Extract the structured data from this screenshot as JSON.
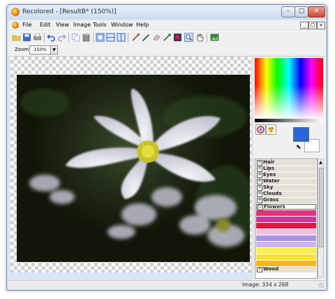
{
  "window": {
    "title": "Recolored - [ResultB* (150%)]"
  },
  "menubar": {
    "items": [
      "File",
      "Edit",
      "View",
      "Image",
      "Tools",
      "Window",
      "Help"
    ]
  },
  "toolbar": {
    "icons": [
      "open-folder-icon",
      "save-icon",
      "print-icon",
      "undo-icon",
      "redo-icon",
      "copy-icon",
      "paste-icon",
      "split-view-icon",
      "split-horizontal-icon",
      "split-vertical-icon",
      "brush-icon",
      "pencil-icon",
      "eraser-icon",
      "dropper-icon",
      "color-fill-icon",
      "zoom-icon",
      "hand-icon",
      "fit-icon"
    ]
  },
  "zoom": {
    "label": "Zoom",
    "value": "150%"
  },
  "palette": {
    "foreground_color": "#2a66d8",
    "background_color": "#ffffff"
  },
  "categories": {
    "items": [
      {
        "label": "Hair",
        "expanded": false
      },
      {
        "label": "Lips",
        "expanded": false
      },
      {
        "label": "Eyes",
        "expanded": false
      },
      {
        "label": "Water",
        "expanded": false
      },
      {
        "label": "Sky",
        "expanded": false
      },
      {
        "label": "Clouds",
        "expanded": false
      },
      {
        "label": "Grass",
        "expanded": false
      },
      {
        "label": "Flowers",
        "expanded": true
      }
    ],
    "flower_colors": [
      "#e0337a",
      "#c9369c",
      "#e8143c",
      "#efc0e3",
      "#a995dd",
      "#c9b6f0",
      "#f7f04a",
      "#f6e23b",
      "#f4b90e"
    ],
    "trailing": {
      "label": "Wood",
      "expanded": false
    }
  },
  "status": {
    "text": "Image: 334 x 268"
  }
}
